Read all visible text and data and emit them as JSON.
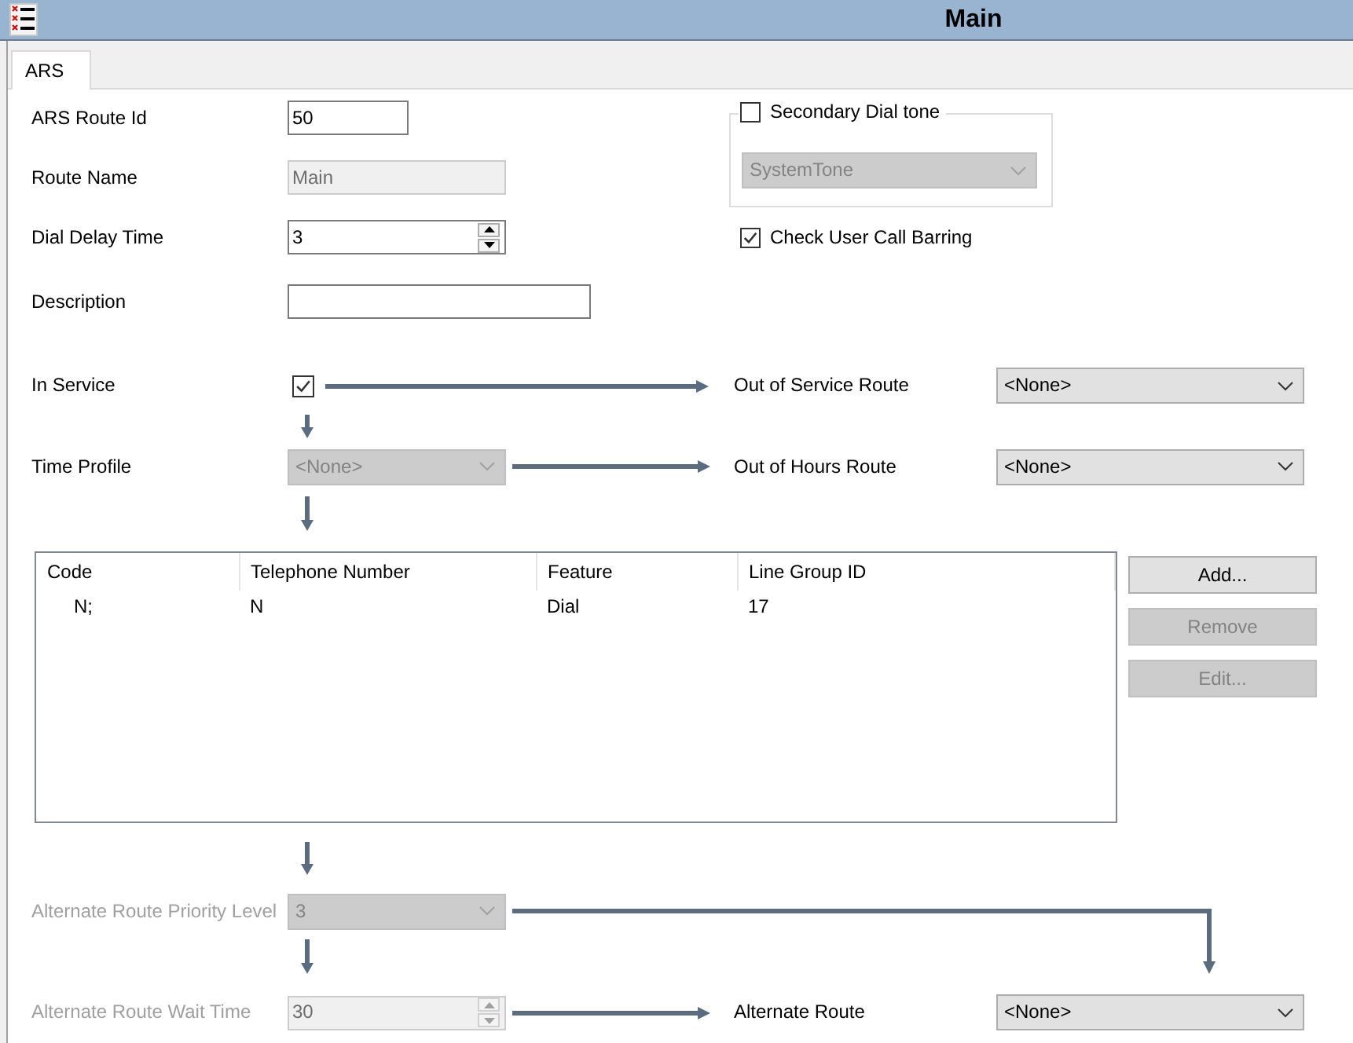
{
  "window": {
    "title": "Main"
  },
  "tabs": [
    {
      "label": "ARS",
      "selected": true
    }
  ],
  "general": [
    {
      "kind": "text",
      "label": "ARS Route Id",
      "value": "50",
      "disabled": false
    },
    {
      "kind": "text",
      "label": "Route Name",
      "value": "Main",
      "disabled": true
    },
    {
      "kind": "spin",
      "label": "Dial Delay Time",
      "value": "3",
      "disabled": false
    },
    {
      "kind": "text",
      "label": "Description",
      "disabled": false
    }
  ],
  "secondary_dial_tone": {
    "label": "Secondary Dial tone",
    "checked": false,
    "select": {
      "value": "SystemTone",
      "disabled": true
    }
  },
  "check_user_call_barring": {
    "label": "Check User Call Barring",
    "checked": true
  },
  "in_service": {
    "label": "In Service",
    "checked": true,
    "route": {
      "label": "Out of Service Route",
      "value": "<None>",
      "disabled": false
    }
  },
  "time_profile": {
    "label": "Time Profile",
    "value": "<None>",
    "disabled": true,
    "route": {
      "label": "Out of Hours Route",
      "value": "<None>",
      "disabled": false
    }
  },
  "table": {
    "columns": [
      "Code",
      "Telephone Number",
      "Feature",
      "Line Group ID"
    ],
    "rows": [
      [
        "N;",
        "N",
        "Dial",
        "17"
      ]
    ]
  },
  "buttons": [
    {
      "label": "Add...",
      "disabled": false
    },
    {
      "label": "Remove",
      "disabled": true
    },
    {
      "label": "Edit...",
      "disabled": true
    }
  ],
  "alternate_priority": {
    "label": "Alternate Route Priority Level",
    "label_disabled": true,
    "value": "3",
    "disabled": true
  },
  "alternate_wait": {
    "label": "Alternate Route Wait Time",
    "label_disabled": true,
    "value": "30",
    "disabled": true,
    "route": {
      "label": "Alternate Route",
      "value": "<None>",
      "disabled": false
    }
  }
}
